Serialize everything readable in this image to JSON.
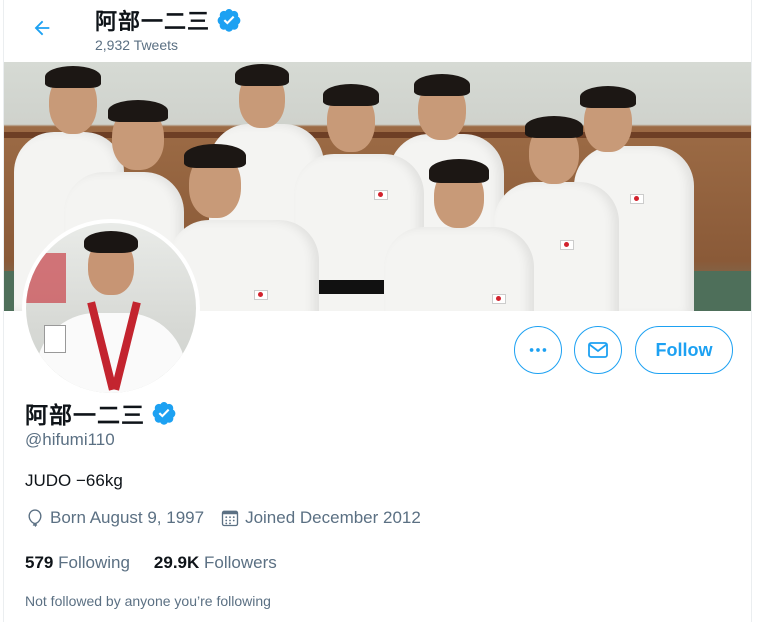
{
  "header": {
    "display_name": "阿部一二三",
    "tweet_count": "2,932 Tweets"
  },
  "profile": {
    "display_name": "阿部一二三",
    "handle": "@hifumi110",
    "bio": "JUDO −66kg",
    "born": "Born August 9, 1997",
    "joined": "Joined December 2012",
    "following_count": "579",
    "following_label": "Following",
    "followers_count": "29.9K",
    "followers_label": "Followers",
    "mutual_notice": "Not followed by anyone you’re following"
  },
  "actions": {
    "follow_label": "Follow",
    "more_icon": "more-horizontal-icon",
    "message_icon": "envelope-icon"
  },
  "colors": {
    "accent": "#1da1f2",
    "secondary_text": "#5b7083",
    "primary_text": "#0f1419"
  }
}
